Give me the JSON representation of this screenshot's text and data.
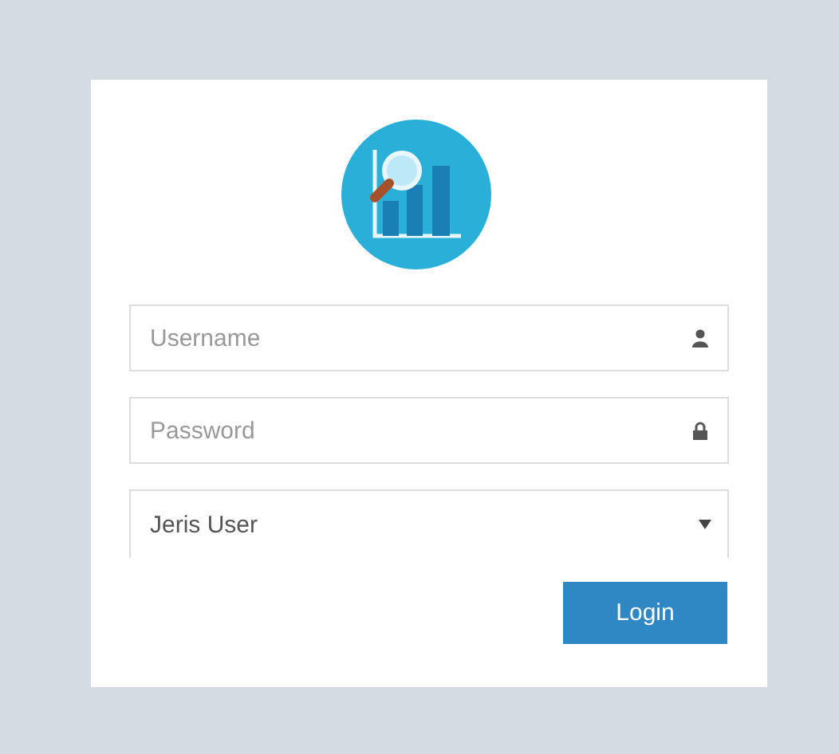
{
  "form": {
    "username": {
      "placeholder": "Username"
    },
    "password": {
      "placeholder": "Password"
    },
    "role": {
      "value": "Jeris User"
    },
    "login_button": "Login"
  }
}
